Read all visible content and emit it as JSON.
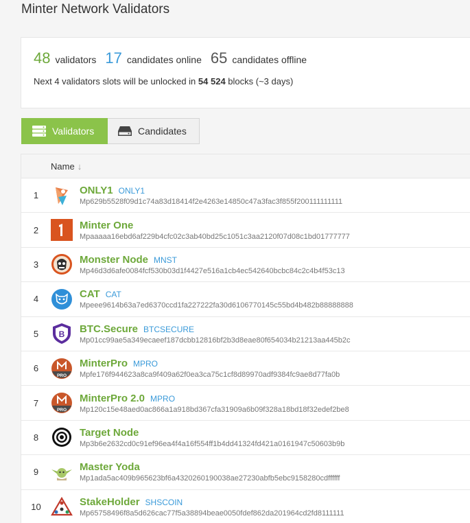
{
  "page": {
    "title": "Minter Network Validators"
  },
  "summary": {
    "validators_count": "48",
    "validators_label": "validators",
    "online_count": "17",
    "online_label": "candidates online",
    "offline_count": "65",
    "offline_label": "candidates offline",
    "unlock_prefix": "Next 4 validators slots will be unlocked in",
    "unlock_blocks": "54 524",
    "unlock_suffix": "blocks (~3 days)"
  },
  "tabs": {
    "validators": "Validators",
    "candidates": "Candidates"
  },
  "table": {
    "header_name": "Name",
    "rows": [
      {
        "rank": "1",
        "name": "ONLY1",
        "ticker": "ONLY1",
        "address": "Mp629b5528f09d1c74a83d18414f2e4263e14850c47a3fac3f855f200111111111",
        "icon": "only1-logo-icon"
      },
      {
        "rank": "2",
        "name": "Minter One",
        "ticker": "",
        "address": "Mpaaaaa16ebd6af229b4cfc02c3ab40bd25c1051c3aa2120f07d08c1bd01777777",
        "icon": "minter-one-logo-icon"
      },
      {
        "rank": "3",
        "name": "Monster Node",
        "ticker": "MNST",
        "address": "Mp46d3d6afe0084fcf530b03d1f4427e516a1cb4ec542640bcbc84c2c4b4f53c13",
        "icon": "monster-node-logo-icon"
      },
      {
        "rank": "4",
        "name": "CAT",
        "ticker": "CAT",
        "address": "Mpeee9614b63a7ed6370ccd1fa227222fa30d6106770145c55bd4b482b88888888",
        "icon": "cat-logo-icon"
      },
      {
        "rank": "5",
        "name": "BTC.Secure",
        "ticker": "BTCSECURE",
        "address": "Mp01cc99ae5a349ecaeef187dcbb12816bf2b3d8eae80f654034b21213aa445b2c",
        "icon": "btc-secure-logo-icon"
      },
      {
        "rank": "6",
        "name": "MinterPro",
        "ticker": "MPRO",
        "address": "Mpfe176f944623a8ca9f409a62f0ea3ca75c1cf8d89970adf9384fc9ae8d77fa0b",
        "icon": "minterpro-logo-icon"
      },
      {
        "rank": "7",
        "name": "MinterPro 2.0",
        "ticker": "MPRO",
        "address": "Mp120c15e48aed0ac866a1a918bd367cfa31909a6b09f328a18bd18f32edef2be8",
        "icon": "minterpro-logo-icon"
      },
      {
        "rank": "8",
        "name": "Target Node",
        "ticker": "",
        "address": "Mp3b6e2632cd0c91ef96ea4f4a16f554ff1b4dd41324fd421a0161947c50603b9b",
        "icon": "target-logo-icon"
      },
      {
        "rank": "9",
        "name": "Master Yoda",
        "ticker": "",
        "address": "Mp1ada5ac409b965623bf6a4320260190038ae27230abfb5ebc9158280cdffffff",
        "icon": "yoda-logo-icon"
      },
      {
        "rank": "10",
        "name": "StakeHolder",
        "ticker": "SHSCOIN",
        "address": "Mp65758496f8a5d626cac77f5a38894beae0050fdef862da201964cd2fd8111111",
        "icon": "stakeholder-logo-icon"
      }
    ]
  },
  "colors": {
    "accent_green": "#8bc34a",
    "name_green": "#6da83a",
    "link_blue": "#3a9ad9"
  }
}
